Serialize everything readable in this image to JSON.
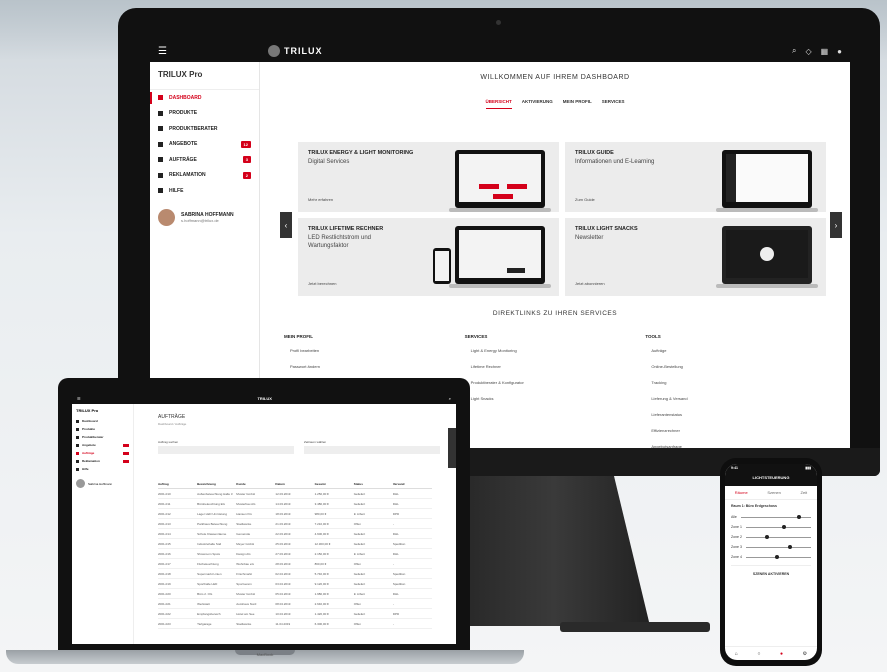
{
  "desktop": {
    "topbar": {
      "menu_icon": "menu-icon",
      "logo_text": "TRILUX",
      "icons": [
        "search-icon",
        "bell-icon",
        "grid-icon",
        "user-icon"
      ]
    },
    "sidebar": {
      "title": "TRILUX  Pro",
      "items": [
        {
          "label": "Dashboard",
          "active": true,
          "badge": ""
        },
        {
          "label": "Produkte",
          "active": false,
          "badge": ""
        },
        {
          "label": "Produktberater",
          "active": false,
          "badge": ""
        },
        {
          "label": "Angebote",
          "active": false,
          "badge": "12"
        },
        {
          "label": "Aufträge",
          "active": false,
          "badge": "3"
        },
        {
          "label": "Reklamation",
          "active": false,
          "badge": "2"
        },
        {
          "label": "Hilfe",
          "active": false,
          "badge": ""
        }
      ],
      "user": {
        "name": "SABRINA HOFFMANN",
        "email": "s.hoffmann@trilux.de"
      }
    },
    "welcome_title": "WILLKOMMEN AUF IHREM DASHBOARD",
    "tabs": [
      {
        "label": "ÜBERSICHT",
        "active": true
      },
      {
        "label": "AKTIVIERUNG",
        "active": false
      },
      {
        "label": "MEIN PROFIL",
        "active": false
      },
      {
        "label": "SERVICES",
        "active": false
      }
    ],
    "cards": [
      {
        "title": "TRILUX ENERGY & LIGHT MONITORING",
        "subtitle": "Digital Services",
        "link": "Mehr erfahren"
      },
      {
        "title": "TRILUX GUIDE",
        "subtitle": "Informationen und E-Learning",
        "link": "Zum Guide"
      },
      {
        "title": "TRILUX LIFETIME RECHNER",
        "subtitle": "LED Restlichtstrom und Wartungsfaktor",
        "link": "Jetzt berechnen"
      },
      {
        "title": "TRILUX LIGHT SNACKS",
        "subtitle": "Newsletter",
        "link": "Jetzt abonnieren"
      }
    ],
    "direct_links_title": "DIREKTLINKS ZU IHREN SERVICES",
    "link_columns": [
      {
        "title": "Mein Profil",
        "items": [
          "Profil bearbeiten",
          "Passwort ändern",
          "Logout"
        ]
      },
      {
        "title": "Services",
        "items": [
          "Light & Energy Monitoring",
          "Lifetime Rechner",
          "Produktberater & Konfigurator",
          "Light Snacks"
        ]
      },
      {
        "title": "Tools",
        "items": [
          "Aufträge",
          "Online-Bestellung",
          "Tracking",
          "Lieferung & Versand",
          "Lieferantenstatus",
          "Effizienzrechner",
          "Angebotsanfrage"
        ]
      }
    ]
  },
  "laptop": {
    "brand": "MacBook",
    "logo_text": "TRILUX",
    "sidebar_title": "TRILUX  Pro",
    "items": [
      "Dashboard",
      "Produkte",
      "Produktberater",
      "Angebote",
      "Aufträge",
      "Reklamation",
      "Hilfe"
    ],
    "user": "Sabrina Hoffmann",
    "page_title": "AUFTRÄGE",
    "breadcrumb": "Dashboard  /  Aufträge",
    "filter_label_1": "Auftrag suchen",
    "filter_label_2": "Zeitraum wählen",
    "columns": [
      "Auftrag",
      "Bezeichnung",
      "Kunde",
      "Datum",
      "Gesamt",
      "Status",
      "Versand"
    ],
    "rows": [
      [
        "2001-010",
        "Außenbeleuchtung Halle 3",
        "Muster GmbH",
        "12.03.2019",
        "1.250,00 €",
        "Geliefert",
        "DHL"
      ],
      [
        "2001-011",
        "Bürobeleuchtung EG",
        "Musterbau AG",
        "14.03.2019",
        "3.480,00 €",
        "Geliefert",
        "DHL"
      ],
      [
        "2001-012",
        "Lager LED Umrüstung",
        "Hansen KG",
        "18.03.2019",
        "980,00 €",
        "In Arbeit",
        "DPD"
      ],
      [
        "2001-013",
        "Parkhaus Beleuchtung",
        "Stadtwerke",
        "21.03.2019",
        "7.210,00 €",
        "Offen",
        "-"
      ],
      [
        "2001-014",
        "Schule Klassenräume",
        "Gemeinde",
        "22.03.2019",
        "4.600,00 €",
        "Geliefert",
        "DHL"
      ],
      [
        "2001-015",
        "Industriehalle Süd",
        "Meyer GmbH",
        "25.03.2019",
        "12.300,00 €",
        "Geliefert",
        "Spedition"
      ],
      [
        "2001-016",
        "Showroom Spots",
        "Design AG",
        "27.03.2019",
        "2.150,00 €",
        "In Arbeit",
        "DHL"
      ],
      [
        "2001-017",
        "Flurbeleuchtung",
        "Wohnbau eG",
        "28.03.2019",
        "860,00 €",
        "Offen",
        "-"
      ],
      [
        "2001-018",
        "Supermarkt Linien",
        "Frischmarkt",
        "02.04.2019",
        "5.740,00 €",
        "Geliefert",
        "Spedition"
      ],
      [
        "2001-019",
        "Sporthalle LED",
        "Sportverein",
        "03.04.2019",
        "9.120,00 €",
        "Geliefert",
        "Spedition"
      ],
      [
        "2001-020",
        "Büro 2. OG",
        "Muster GmbH",
        "05.04.2019",
        "1.980,00 €",
        "In Arbeit",
        "DHL"
      ],
      [
        "2001-021",
        "Werkstatt",
        "Autohaus Nord",
        "08.04.2019",
        "2.640,00 €",
        "Offen",
        "-"
      ],
      [
        "2001-022",
        "Empfangsbereich",
        "Hotel am See",
        "10.04.2019",
        "1.420,00 €",
        "Geliefert",
        "DPD"
      ],
      [
        "2001-023",
        "Tiefgarage",
        "Stadtwerke",
        "11.04.2019",
        "6.300,00 €",
        "Offen",
        "-"
      ]
    ]
  },
  "phone": {
    "status_time": "9:41",
    "header": "LICHTSTEUERUNG",
    "tabs": [
      "Räume",
      "Szenen",
      "Zeit"
    ],
    "room": "Raum 1: Büro Erdgeschoss",
    "controls": [
      {
        "label": "Alle",
        "value": 0.8
      },
      {
        "label": "Zone 1",
        "value": 0.55
      },
      {
        "label": "Zone 2",
        "value": 0.3
      },
      {
        "label": "Zone 3",
        "value": 0.65
      },
      {
        "label": "Zone 4",
        "value": 0.45
      }
    ],
    "scene_label": "SZENEN AKTIVIEREN"
  }
}
